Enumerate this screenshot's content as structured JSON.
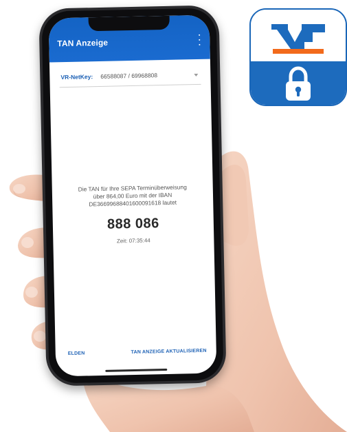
{
  "app": {
    "title": "TAN Anzeige"
  },
  "netkey": {
    "label": "VR-NetKey:",
    "value": "66588087 / 69968808"
  },
  "message": {
    "line1": "Die TAN für Ihre SEPA Terminüberweisung",
    "line2": "über 864,00 Euro mit der IBAN",
    "line3": "DE36699688401600091618 lautet"
  },
  "tan": {
    "code": "888 086",
    "time": "Zeit: 07:35:44"
  },
  "footer": {
    "left_label": "ELDEN",
    "right_label": "TAN ANZEIGE AKTUALISIEREN"
  },
  "colors": {
    "header_blue": "#1463c4",
    "link_blue": "#1a5fb4",
    "icon_blue": "#1d6bbd",
    "icon_orange": "#f26a1b"
  },
  "icons": {
    "menu": "more-vert-icon",
    "dropdown": "chevron-down-icon",
    "app_logo": "vr-bank-logo",
    "lock": "lock-icon"
  }
}
